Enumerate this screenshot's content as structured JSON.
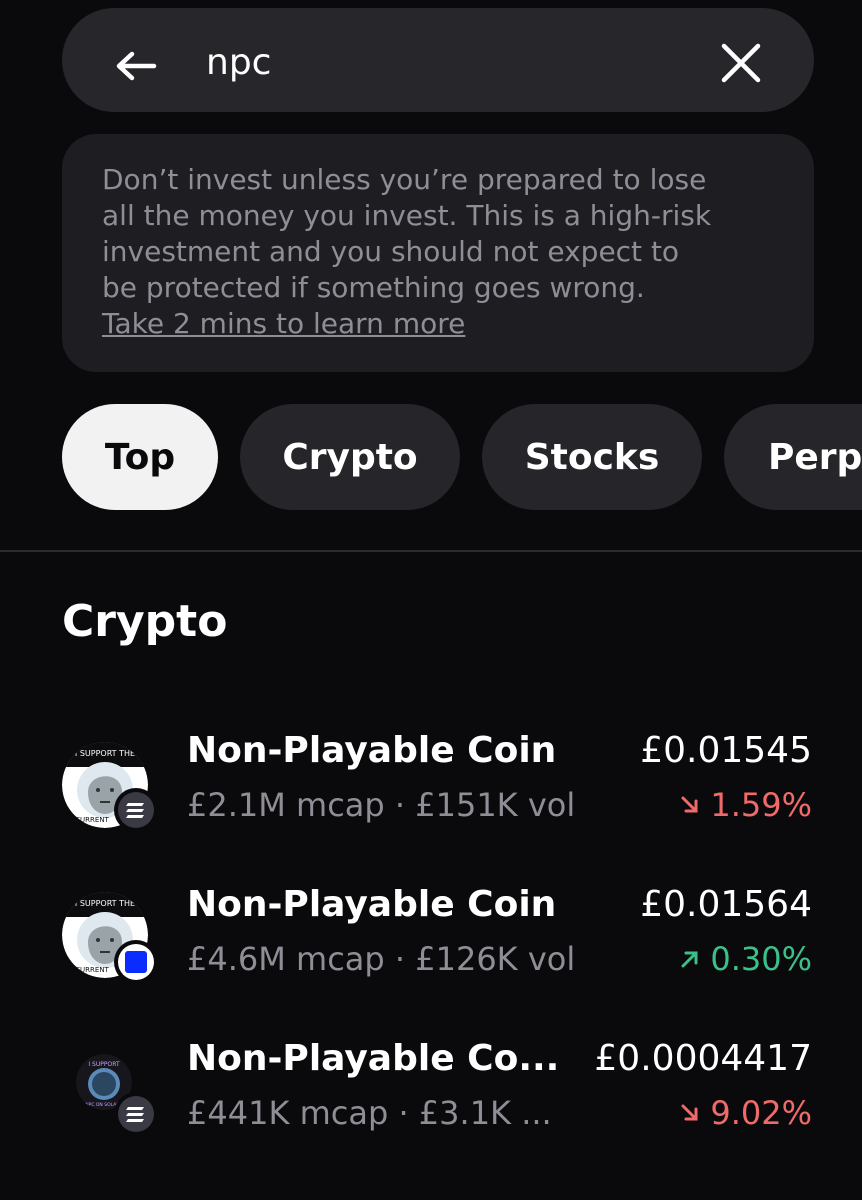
{
  "search": {
    "query": "npc"
  },
  "warning": {
    "lines": [
      "Don’t invest unless you’re prepared to lose",
      "all the money you invest. This is a high-risk",
      "investment and you should not expect to",
      "be protected if something goes wrong."
    ],
    "link": "Take 2 mins to learn more"
  },
  "filters": {
    "items": [
      {
        "label": "Top",
        "active": true
      },
      {
        "label": "Crypto",
        "active": false
      },
      {
        "label": "Stocks",
        "active": false
      },
      {
        "label": "Perp",
        "active": false
      }
    ]
  },
  "section": {
    "title": "Crypto"
  },
  "results": [
    {
      "name": "Non-Playable Coin",
      "meta": "£2.1M mcap · £151K vol",
      "price": "£0.01545",
      "change": "1.59%",
      "direction": "down",
      "avatar_text": "I SUPPORT THE",
      "avatar_text_bottom": "CURRENT",
      "chain_icon": "solana-icon"
    },
    {
      "name": "Non-Playable Coin",
      "meta": "£4.6M mcap · £126K vol",
      "price": "£0.01564",
      "change": "0.30%",
      "direction": "up",
      "avatar_text": "I SUPPORT THE",
      "avatar_text_bottom": "CURRENT",
      "chain_icon": "base-icon"
    },
    {
      "name": "Non-Playable Co...",
      "meta": "£441K mcap · £3.1K ...",
      "price": "£0.0004417",
      "change": "9.02%",
      "direction": "down",
      "avatar_text": "I SUPPORT",
      "avatar_text_bottom": "NPC ON SOLANA",
      "chain_icon": "solana-icon"
    }
  ],
  "colors": {
    "background": "#0a0a0c",
    "surface": "#26262b",
    "negative": "#f06a6a",
    "positive": "#3cc08a",
    "muted_text": "#8e8e96"
  }
}
